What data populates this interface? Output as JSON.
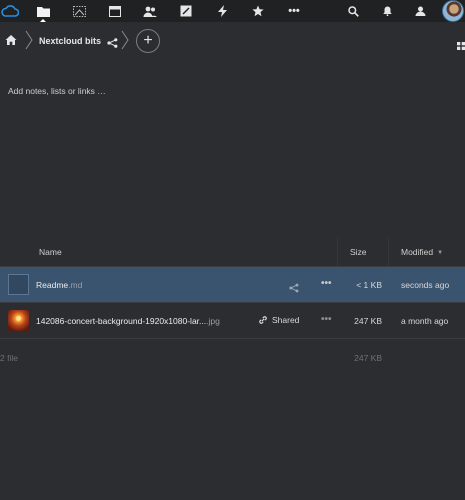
{
  "header": {
    "apps": [
      {
        "icon": "cloud-logo-icon"
      },
      {
        "icon": "files-icon",
        "active": true
      },
      {
        "icon": "photos-icon"
      },
      {
        "icon": "calendar-icon"
      },
      {
        "icon": "contacts-icon"
      },
      {
        "icon": "notes-icon"
      },
      {
        "icon": "activity-icon"
      },
      {
        "icon": "favorites-star-icon"
      },
      {
        "icon": "more-apps-icon"
      }
    ],
    "right_icons": [
      "search-icon",
      "notifications-icon",
      "contacts-menu-icon"
    ],
    "accent": "#1f2122"
  },
  "breadcrumb": {
    "folder": "Nextcloud bits"
  },
  "notes": {
    "placeholder": "Add notes, lists or links …"
  },
  "table": {
    "headers": {
      "name": "Name",
      "size": "Size",
      "modified": "Modified"
    },
    "rows": [
      {
        "basename": "Readme",
        "ext": ".md",
        "size": "< 1 KB",
        "modified": "seconds ago",
        "selected": true,
        "shared_label": ""
      },
      {
        "basename": "142086-concert-background-1920x1080-lar...",
        "ext": ".jpg",
        "size": "247 KB",
        "modified": "a month ago",
        "selected": false,
        "shared_label": "Shared"
      }
    ],
    "summary": {
      "count": "2 file",
      "size": "247 KB"
    }
  },
  "colors": {
    "background": "#2b2d30",
    "header": "#1f2122",
    "selected_row": "#3a5470",
    "brand_blue": "#0082c9"
  }
}
